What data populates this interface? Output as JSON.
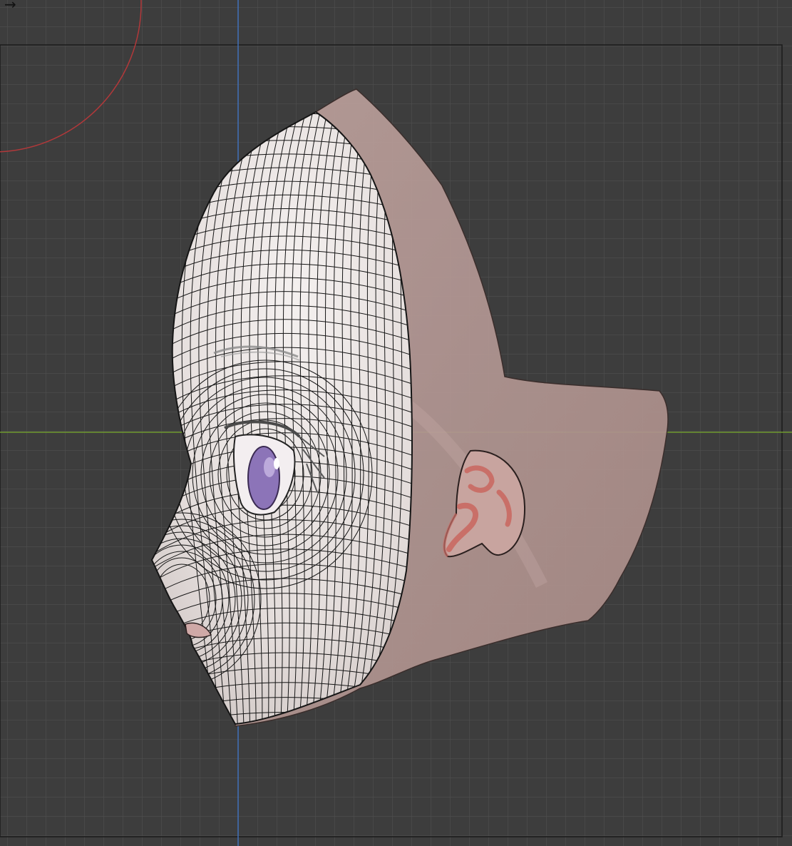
{
  "viewport": {
    "background_color": "#3d3d3d",
    "grid_color": "#4f4f4f",
    "axis_x_color": "#6e9a2e",
    "axis_y_color": "#3f6fb8",
    "camera_frame_color": "#1b1b1b",
    "gizmo_circle_color": "#b2383a"
  },
  "gizmo": {
    "icon": "arrow-right-icon",
    "glyph": "→"
  },
  "model": {
    "mesh_fill": "#ece6e4",
    "wire_color": "#151515",
    "ref_skin_color": "#bfa29d",
    "ear_color": "#c96f68",
    "iris_color": "#8c74b8"
  }
}
